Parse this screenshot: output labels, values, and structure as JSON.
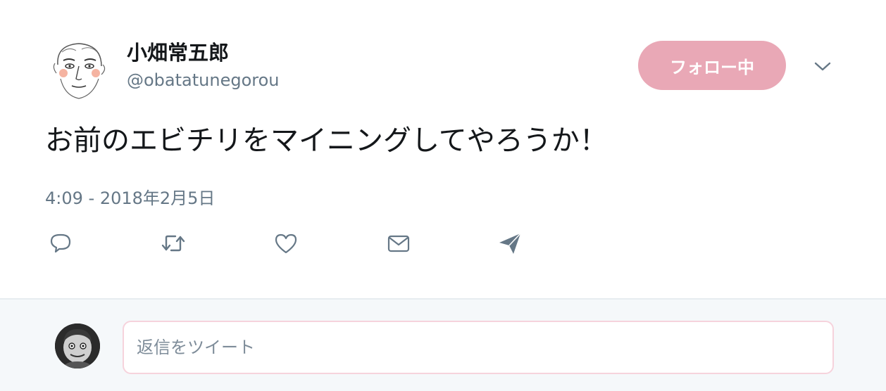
{
  "author": {
    "display_name": "小畑常五郎",
    "handle": "@obatatunegorou",
    "avatar_icon": "sketch-portrait-avatar"
  },
  "follow_button": {
    "label": "フォロー中",
    "color": "#e9a8b6"
  },
  "menu": {
    "icon": "chevron-down-icon"
  },
  "tweet": {
    "text": "お前のエビチリをマイニングしてやろうか！",
    "timestamp": "4:09 - 2018年2月5日"
  },
  "actions": [
    {
      "name": "reply",
      "icon": "reply-icon"
    },
    {
      "name": "retweet",
      "icon": "retweet-icon"
    },
    {
      "name": "like",
      "icon": "heart-icon"
    },
    {
      "name": "direct-message",
      "icon": "envelope-icon"
    },
    {
      "name": "share",
      "icon": "paper-plane-icon"
    }
  ],
  "reply": {
    "placeholder": "返信をツイート",
    "avatar_icon": "user-avatar"
  },
  "colors": {
    "text_primary": "#14171a",
    "text_secondary": "#657786",
    "icon": "#657786",
    "reply_background": "#f5f8fa",
    "input_border": "#f6d3dc"
  }
}
